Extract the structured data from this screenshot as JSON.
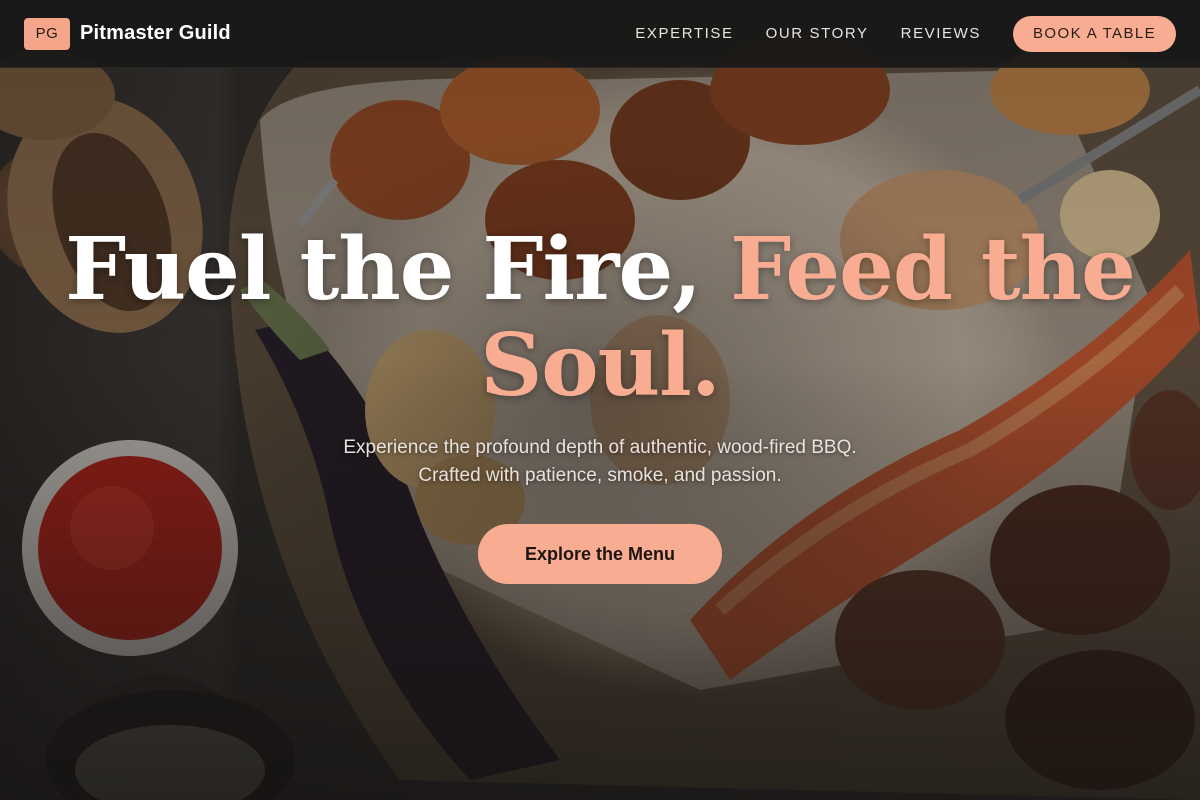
{
  "brand": {
    "mark": "PG",
    "name": "Pitmaster Guild"
  },
  "nav": {
    "links": [
      "EXPERTISE",
      "OUR STORY",
      "REVIEWS"
    ],
    "cta_label": "BOOK A TABLE"
  },
  "hero": {
    "headline_part1": "Fuel the Fire,",
    "headline_accent": "Feed the Soul.",
    "subtitle_line1": "Experience the profound depth of authentic, wood-fired BBQ.",
    "subtitle_line2": "Crafted with patience, smoke, and passion.",
    "cta_label": "Explore the Menu"
  },
  "colors": {
    "accent": "#f8ad93",
    "header_bg": "#181818",
    "text_light": "#ffffff"
  },
  "icons": {
    "hero_background": "bbq-platter-photo"
  }
}
